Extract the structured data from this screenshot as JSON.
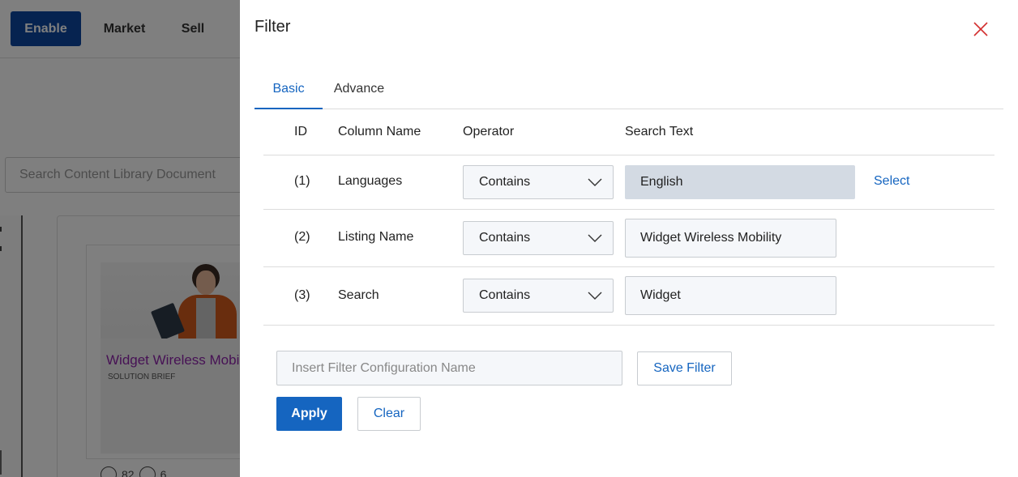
{
  "background": {
    "nav": {
      "enable": "Enable",
      "market": "Market",
      "sell": "Sell"
    },
    "search_placeholder": "Search Content Library Document",
    "card": {
      "title": "Widget Wireless Mobility",
      "subtitle": "SOLUTION BRIEF",
      "views": "82",
      "downloads": "6"
    }
  },
  "drawer": {
    "title": "Filter",
    "close_icon": "close-icon",
    "tabs": [
      {
        "label": "Basic",
        "active": true
      },
      {
        "label": "Advance",
        "active": false
      }
    ],
    "table": {
      "headers": {
        "id": "ID",
        "column": "Column Name",
        "operator": "Operator",
        "search": "Search Text"
      },
      "rows": [
        {
          "id": "(1)",
          "column": "Languages",
          "operator": "Contains",
          "value": "English",
          "readonly": true,
          "action": "Select"
        },
        {
          "id": "(2)",
          "column": "Listing Name",
          "operator": "Contains",
          "value": "Widget Wireless Mobility",
          "readonly": false
        },
        {
          "id": "(3)",
          "column": "Search",
          "operator": "Contains",
          "value": "Widget",
          "readonly": false
        }
      ]
    },
    "config_name_placeholder": "Insert Filter Configuration Name",
    "save_filter_label": "Save Filter",
    "apply_label": "Apply",
    "clear_label": "Clear"
  },
  "colors": {
    "accent": "#1565c0",
    "nav_primary": "#0d47a1",
    "close_icon": "#d32f2f",
    "readonly_field": "#d3dae3",
    "card_title": "#8e24aa"
  }
}
